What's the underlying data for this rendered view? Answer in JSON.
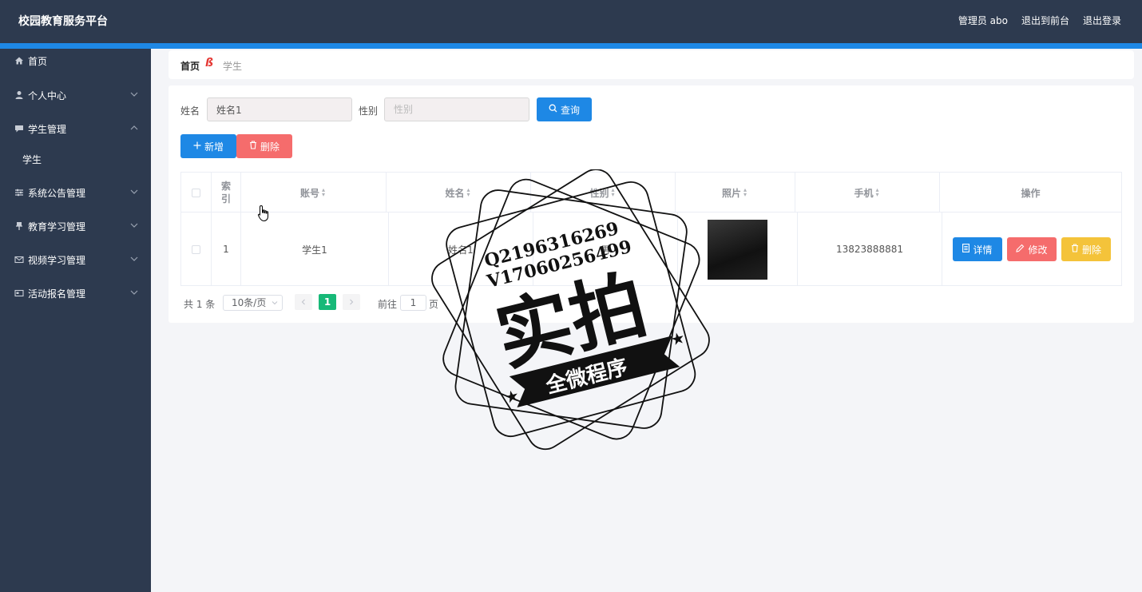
{
  "header": {
    "title": "校园教育服务平台",
    "user": "管理员 abo",
    "to_front": "退出到前台",
    "logout": "退出登录"
  },
  "sidebar": {
    "items": [
      {
        "label": "首页",
        "icon": "home-icon"
      },
      {
        "label": "个人中心",
        "icon": "user-icon"
      },
      {
        "label": "学生管理",
        "icon": "chat-icon",
        "expanded": true,
        "children": [
          "学生"
        ]
      },
      {
        "label": "系统公告管理",
        "icon": "sliders-icon"
      },
      {
        "label": "教育学习管理",
        "icon": "pin-icon"
      },
      {
        "label": "视频学习管理",
        "icon": "mail-icon"
      },
      {
        "label": "活动报名管理",
        "icon": "card-icon"
      }
    ]
  },
  "breadcrumb": {
    "home": "首页",
    "separator": "ß",
    "current": "学生"
  },
  "search": {
    "name_label": "姓名",
    "name_value": "姓名1",
    "gender_label": "性别",
    "gender_placeholder": "性别",
    "query_button": "查询"
  },
  "actions": {
    "add": "新增",
    "delete": "删除"
  },
  "table": {
    "columns": [
      "索引",
      "账号",
      "姓名",
      "性别",
      "照片",
      "手机",
      "操作"
    ],
    "rows": [
      {
        "index": "1",
        "account": "学生1",
        "name": "姓名1",
        "gender": "男",
        "phone": "13823888881"
      }
    ],
    "row_actions": {
      "detail": "详情",
      "edit": "修改",
      "delete": "删除"
    }
  },
  "pagination": {
    "total_text": "共 1 条",
    "page_size": "10条/页",
    "current_page": "1",
    "goto_label": "前往",
    "goto_value": "1",
    "page_suffix": "页"
  },
  "watermark": {
    "line1": "Q2196316269",
    "line2": "V17060256499",
    "big": "实拍",
    "banner": "全微程序"
  },
  "colors": {
    "sidebar_bg": "#2d3a4f",
    "accent_blue": "#1e88e5",
    "danger_red": "#f56c6c",
    "warning_yellow": "#f4c33a",
    "pager_green": "#17b978"
  }
}
